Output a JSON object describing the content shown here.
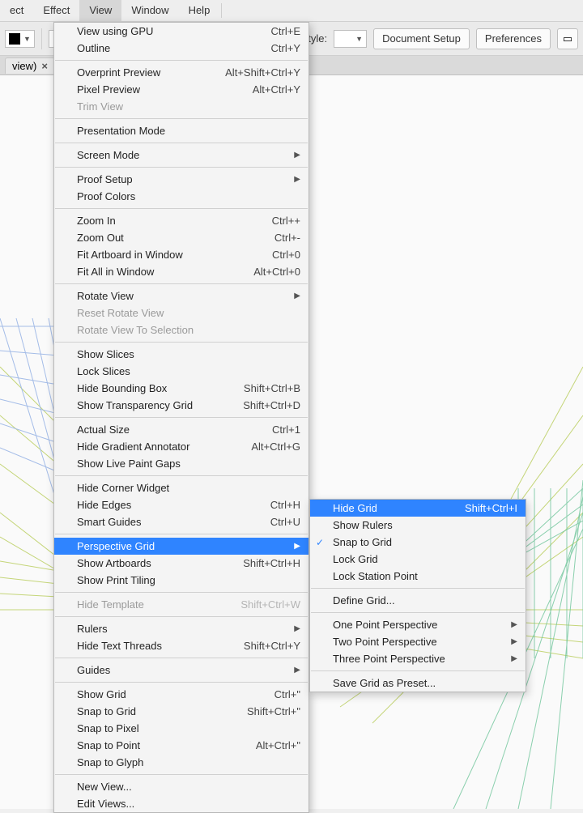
{
  "menubar": {
    "items": [
      "ect",
      "Effect",
      "View",
      "Window",
      "Help"
    ],
    "activeIndex": 2
  },
  "toolbar": {
    "styleLabel": "Style:",
    "docSetup": "Document Setup",
    "prefs": "Preferences"
  },
  "tab": {
    "title": "view)",
    "close": "×"
  },
  "menu": {
    "g0": [
      {
        "label": "View using GPU",
        "shortcut": "Ctrl+E"
      },
      {
        "label": "Outline",
        "shortcut": "Ctrl+Y"
      }
    ],
    "g1": [
      {
        "label": "Overprint Preview",
        "shortcut": "Alt+Shift+Ctrl+Y"
      },
      {
        "label": "Pixel Preview",
        "shortcut": "Alt+Ctrl+Y"
      },
      {
        "label": "Trim View",
        "disabled": true
      }
    ],
    "g2": [
      {
        "label": "Presentation Mode"
      }
    ],
    "g3": [
      {
        "label": "Screen Mode",
        "arrow": true
      }
    ],
    "g4": [
      {
        "label": "Proof Setup",
        "arrow": true
      },
      {
        "label": "Proof Colors"
      }
    ],
    "g5": [
      {
        "label": "Zoom In",
        "shortcut": "Ctrl++"
      },
      {
        "label": "Zoom Out",
        "shortcut": "Ctrl+-"
      },
      {
        "label": "Fit Artboard in Window",
        "shortcut": "Ctrl+0"
      },
      {
        "label": "Fit All in Window",
        "shortcut": "Alt+Ctrl+0"
      }
    ],
    "g6": [
      {
        "label": "Rotate View",
        "arrow": true
      },
      {
        "label": "Reset Rotate View",
        "disabled": true
      },
      {
        "label": "Rotate View To Selection",
        "disabled": true
      }
    ],
    "g7": [
      {
        "label": "Show Slices"
      },
      {
        "label": "Lock Slices"
      },
      {
        "label": "Hide Bounding Box",
        "shortcut": "Shift+Ctrl+B"
      },
      {
        "label": "Show Transparency Grid",
        "shortcut": "Shift+Ctrl+D"
      }
    ],
    "g8": [
      {
        "label": "Actual Size",
        "shortcut": "Ctrl+1"
      },
      {
        "label": "Hide Gradient Annotator",
        "shortcut": "Alt+Ctrl+G"
      },
      {
        "label": "Show Live Paint Gaps"
      }
    ],
    "g9": [
      {
        "label": "Hide Corner Widget"
      },
      {
        "label": "Hide Edges",
        "shortcut": "Ctrl+H"
      },
      {
        "label": "Smart Guides",
        "shortcut": "Ctrl+U"
      }
    ],
    "g10": [
      {
        "label": "Perspective Grid",
        "arrow": true,
        "highlight": true
      },
      {
        "label": "Show Artboards",
        "shortcut": "Shift+Ctrl+H"
      },
      {
        "label": "Show Print Tiling"
      }
    ],
    "g11": [
      {
        "label": "Hide Template",
        "shortcut": "Shift+Ctrl+W",
        "disabled": true
      }
    ],
    "g12": [
      {
        "label": "Rulers",
        "arrow": true
      },
      {
        "label": "Hide Text Threads",
        "shortcut": "Shift+Ctrl+Y"
      }
    ],
    "g13": [
      {
        "label": "Guides",
        "arrow": true
      }
    ],
    "g14": [
      {
        "label": "Show Grid",
        "shortcut": "Ctrl+\""
      },
      {
        "label": "Snap to Grid",
        "shortcut": "Shift+Ctrl+\""
      },
      {
        "label": "Snap to Pixel"
      },
      {
        "label": "Snap to Point",
        "shortcut": "Alt+Ctrl+\""
      },
      {
        "label": "Snap to Glyph"
      }
    ],
    "g15": [
      {
        "label": "New View..."
      },
      {
        "label": "Edit Views..."
      }
    ]
  },
  "submenu": {
    "s0": [
      {
        "label": "Hide Grid",
        "shortcut": "Shift+Ctrl+I",
        "highlight": true
      },
      {
        "label": "Show Rulers"
      },
      {
        "label": "Snap to Grid",
        "checked": true
      },
      {
        "label": "Lock Grid"
      },
      {
        "label": "Lock Station Point"
      }
    ],
    "s1": [
      {
        "label": "Define Grid..."
      }
    ],
    "s2": [
      {
        "label": "One Point Perspective",
        "arrow": true
      },
      {
        "label": "Two Point Perspective",
        "arrow": true
      },
      {
        "label": "Three Point Perspective",
        "arrow": true
      }
    ],
    "s3": [
      {
        "label": "Save Grid as Preset..."
      }
    ]
  }
}
